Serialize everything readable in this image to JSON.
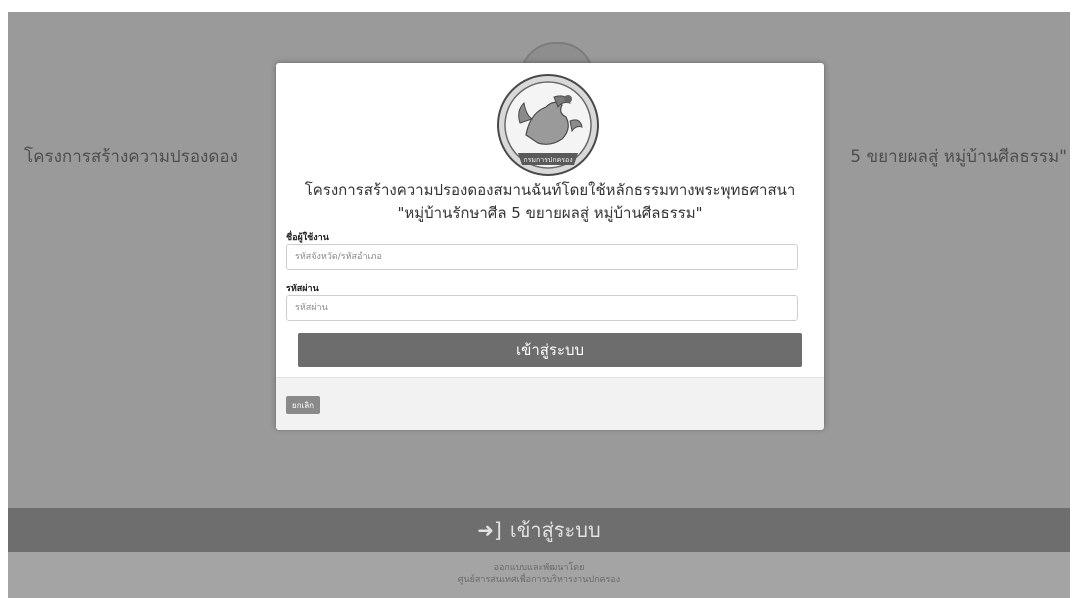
{
  "background": {
    "title_left": "โครงการสร้างความปรองดอง",
    "title_right": "5 ขยายผลสู่ หมู่บ้านศีลธรรม\"",
    "login_bar_icon": "sign-in-icon",
    "login_bar_icon_glyph": "➜]",
    "login_bar_label": "เข้าสู่ระบบ",
    "footer_line1": "ออกแบบและพัฒนาโดย",
    "footer_line2": "ศูนย์สารสนเทศเพื่อการบริหารงานปกครอง"
  },
  "modal": {
    "title": "โครงการสร้างความปรองดองสมานฉันท์โดยใช้หลักธรรมทางพระพุทธศาสนา",
    "subtitle": "\"หมู่บ้านรักษาศีล 5 ขยายผลสู่ หมู่บ้านศีลธรรม\"",
    "seal_icon": "government-seal-icon",
    "seal_text": "กรมการปกครอง",
    "username": {
      "label": "ชื่อผู้ใช้งาน",
      "placeholder": "รหัสจังหวัด/รหัสอำเภอ",
      "value": ""
    },
    "password": {
      "label": "รหัสผ่าน",
      "placeholder": "รหัสผ่าน",
      "value": ""
    },
    "login_button": "เข้าสู่ระบบ",
    "cancel_button": "ยกเลิก"
  },
  "colors": {
    "overlay": "#9a9a9a",
    "button": "#6d6d6d",
    "cancel": "#8a8a8a"
  }
}
